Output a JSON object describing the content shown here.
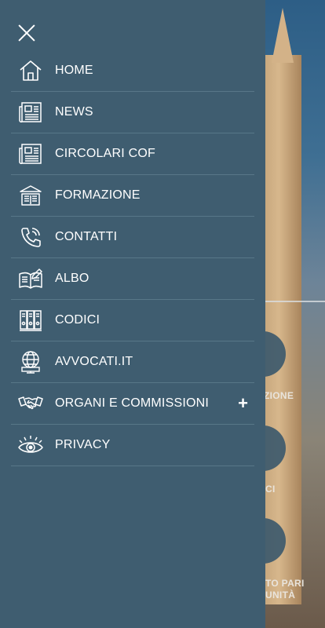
{
  "theme": {
    "drawer_bg": "#3f5d70",
    "divider": "#587788",
    "text": "#ffffff"
  },
  "drawer": {
    "items": [
      {
        "label": "HOME",
        "icon": "home-icon"
      },
      {
        "label": "NEWS",
        "icon": "newspaper-icon"
      },
      {
        "label": "CIRCOLARI COF",
        "icon": "newspaper-icon"
      },
      {
        "label": "FORMAZIONE",
        "icon": "library-icon"
      },
      {
        "label": "CONTATTI",
        "icon": "phone-icon"
      },
      {
        "label": "ALBO",
        "icon": "book-edit-icon"
      },
      {
        "label": "CODICI",
        "icon": "binders-icon"
      },
      {
        "label": "AVVOCATI.IT",
        "icon": "globe-monitor-icon"
      },
      {
        "label": "ORGANI E COMMISSIONI",
        "icon": "handshake-icon",
        "expand": "+"
      },
      {
        "label": "PRIVACY",
        "icon": "eye-icon"
      }
    ]
  },
  "background": {
    "tile_labels": [
      "ZIONE",
      "CI",
      "TO PARI",
      "UNITÀ"
    ]
  }
}
